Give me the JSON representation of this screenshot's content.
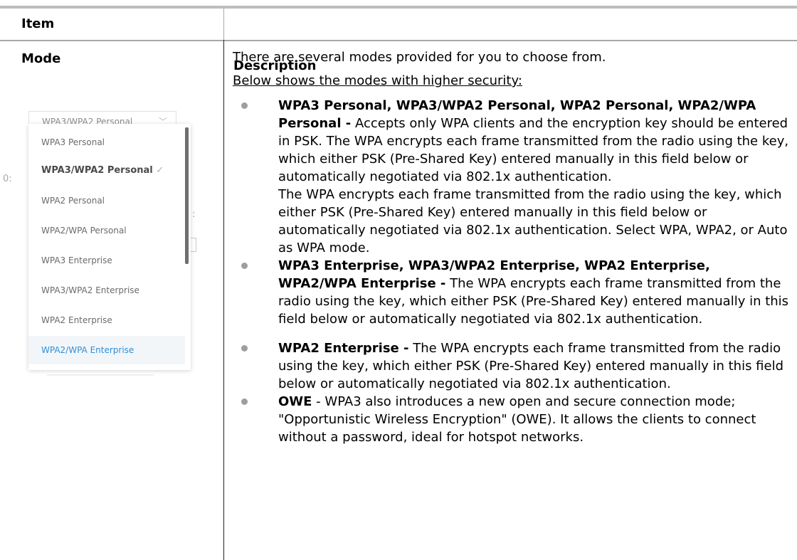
{
  "table": {
    "col_item": "Item",
    "col_description": "Description"
  },
  "mode": {
    "label": "Mode"
  },
  "dropdown": {
    "selected_value": "WPA3/WPA2 Personal",
    "chevron": "chevron-down-icon",
    "options": [
      "WPA3 Personal",
      "WPA3/WPA2 Personal",
      "WPA2 Personal",
      "WPA2/WPA Personal",
      "WPA3 Enterprise",
      "WPA3/WPA2 Enterprise",
      "WPA2 Enterprise",
      "WPA2/WPA Enterprise"
    ],
    "checked_option": "WPA3/WPA2 Personal",
    "check_mark": "✓",
    "hovered_option": "WPA2/WPA Enterprise",
    "background_fragment_1": "0:",
    "background_fragment_2": ":"
  },
  "description": {
    "intro": "There are several modes provided for you to choose from.",
    "underlined": "Below shows the modes with higher security:",
    "bullets": [
      {
        "title": "WPA3 Personal, WPA3/WPA2 Personal, WPA2 Personal, WPA2/WPA Personal -",
        "text": " Accepts only WPA clients and the encryption key should be entered in PSK. The WPA encrypts each frame transmitted from the radio using the key, which either PSK (Pre-Shared Key) entered manually in this field below or automatically negotiated via 802.1x authentication.",
        "extra": "The WPA encrypts each frame transmitted from the radio using the key, which either PSK (Pre-Shared Key) entered manually in this field below or automatically negotiated via 802.1x authentication. Select WPA, WPA2, or Auto as WPA mode."
      },
      {
        "title": "WPA3 Enterprise, WPA3/WPA2 Enterprise, WPA2 Enterprise, WPA2/WPA Enterprise -",
        "text": " The WPA encrypts each frame transmitted from the radio using the key, which either PSK (Pre-Shared Key) entered manually in this field below or automatically negotiated via 802.1x authentication."
      },
      {
        "title": "WPA2 Enterprise -",
        "text": " The WPA encrypts each frame transmitted from the radio using the key, which either PSK (Pre-Shared Key) entered manually in this field below or automatically negotiated via 802.1x authentication."
      },
      {
        "title": "OWE",
        "text": " - WPA3 also introduces a new open and secure connection mode; \"Opportunistic Wireless Encryption\" (OWE). It allows the clients to connect without a password, ideal for hotspot networks."
      }
    ]
  }
}
